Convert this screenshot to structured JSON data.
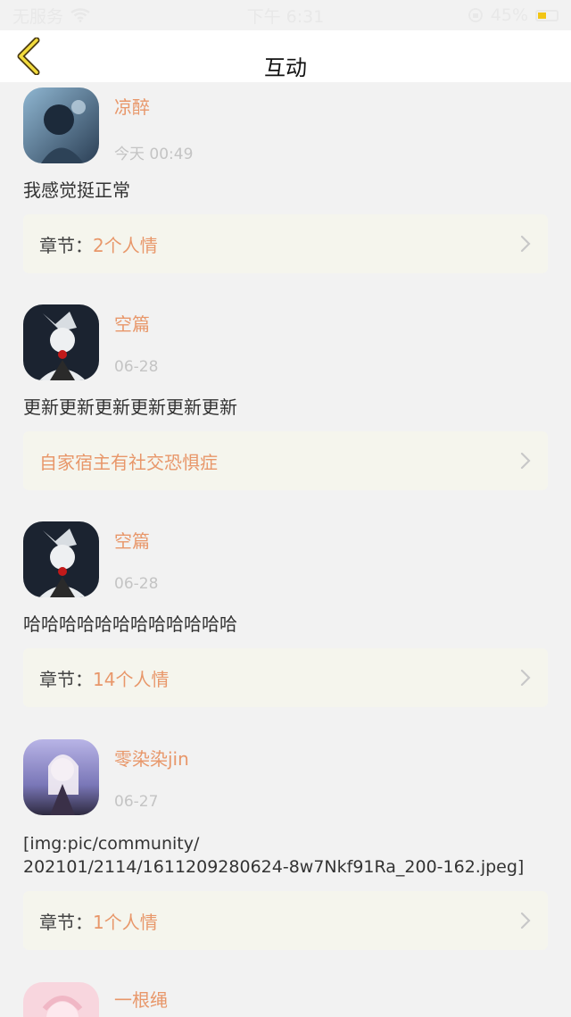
{
  "status_bar": {
    "carrier": "无服务",
    "time": "下午 6:31",
    "battery": "45%",
    "battery_level": 0.45
  },
  "nav": {
    "title": "互动",
    "back_icon": "chevron-left-icon"
  },
  "comments": [
    {
      "username": "凉醉",
      "time": "今天 00:49",
      "text": "我感觉挺正常",
      "chapter_label": "章节：",
      "chapter_value": "2个人情"
    },
    {
      "username": "空篇",
      "time": "06-28",
      "text": "更新更新更新更新更新更新",
      "chapter_label": "",
      "chapter_value": "自家宿主有社交恐惧症"
    },
    {
      "username": "空篇",
      "time": "06-28",
      "text": "哈哈哈哈哈哈哈哈哈哈哈哈",
      "chapter_label": "章节：",
      "chapter_value": "14个人情"
    },
    {
      "username": "零染染jin",
      "time": "06-27",
      "text": "[img:pic/community/\n202101/2114/1611209280624-8w7Nkf91Ra_200-162.jpeg]",
      "chapter_label": "章节：",
      "chapter_value": "1个人情"
    },
    {
      "username": "一根绳"
    }
  ],
  "colors": {
    "accent": "#e8976a",
    "chapter_bg": "#f5f5ed",
    "page_bg": "#f2f2f2"
  }
}
